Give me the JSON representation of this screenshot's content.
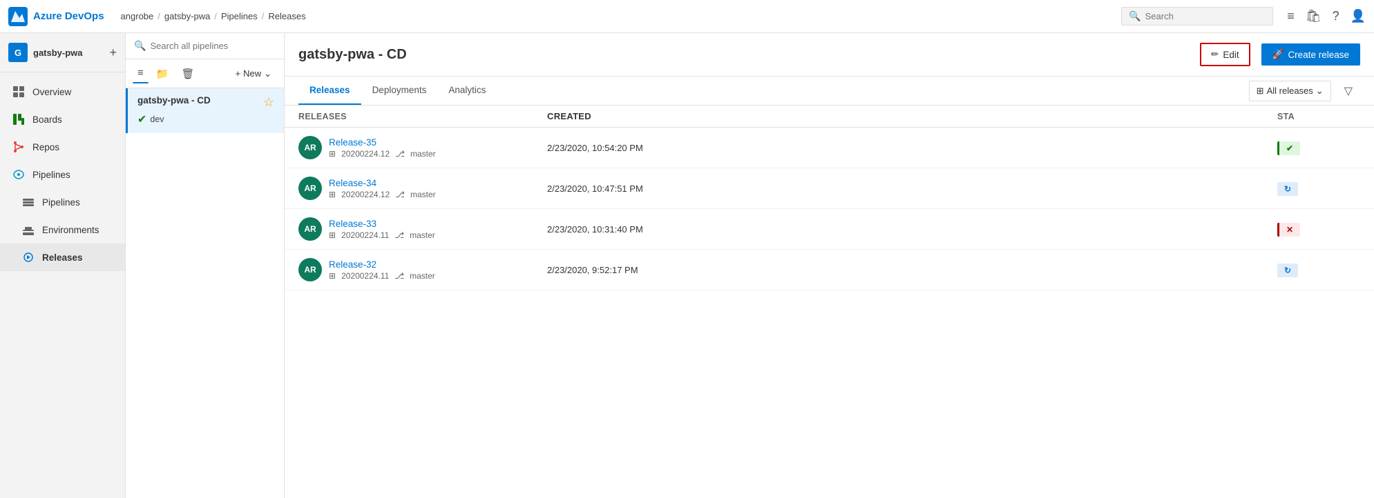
{
  "app": {
    "name": "Azure DevOps",
    "logo_color": "#0078d4"
  },
  "breadcrumb": {
    "items": [
      "angrobe",
      "/",
      "gatsby-pwa",
      "/",
      "Pipelines",
      "/",
      "Releases"
    ]
  },
  "topbar": {
    "search_placeholder": "Search"
  },
  "sidebar": {
    "project_initial": "G",
    "project_name": "gatsby-pwa",
    "items": [
      {
        "id": "overview",
        "label": "Overview",
        "icon": "overview"
      },
      {
        "id": "boards",
        "label": "Boards",
        "icon": "boards"
      },
      {
        "id": "repos",
        "label": "Repos",
        "icon": "repos"
      },
      {
        "id": "pipelines-group",
        "label": "Pipelines",
        "icon": "pipelines",
        "group": true
      },
      {
        "id": "pipelines",
        "label": "Pipelines",
        "icon": "pipelines-sub"
      },
      {
        "id": "environments",
        "label": "Environments",
        "icon": "environments"
      },
      {
        "id": "releases",
        "label": "Releases",
        "icon": "releases",
        "active": true
      }
    ]
  },
  "pipeline_panel": {
    "search_placeholder": "Search all pipelines",
    "toolbar": {
      "list_label": "List view",
      "folder_label": "Folder",
      "delete_label": "Delete",
      "new_label": "New",
      "chevron_label": "More"
    },
    "selected_pipeline": {
      "name": "gatsby-pwa - CD",
      "env": "dev",
      "env_status": "success"
    }
  },
  "content": {
    "title": "gatsby-pwa - CD",
    "edit_label": "Edit",
    "create_release_label": "Create release",
    "tabs": [
      {
        "id": "releases",
        "label": "Releases",
        "active": true
      },
      {
        "id": "deployments",
        "label": "Deployments"
      },
      {
        "id": "analytics",
        "label": "Analytics"
      }
    ],
    "all_releases_label": "All releases",
    "table": {
      "col_releases": "Releases",
      "col_created": "Created",
      "col_status": "Sta",
      "rows": [
        {
          "avatar": "AR",
          "name": "Release-35",
          "build": "20200224.12",
          "branch": "master",
          "created": "2/23/2020, 10:54:20 PM",
          "status": "success"
        },
        {
          "avatar": "AR",
          "name": "Release-34",
          "build": "20200224.12",
          "branch": "master",
          "created": "2/23/2020, 10:47:51 PM",
          "status": "inprogress"
        },
        {
          "avatar": "AR",
          "name": "Release-33",
          "build": "20200224.11",
          "branch": "master",
          "created": "2/23/2020, 10:31:40 PM",
          "status": "failed"
        },
        {
          "avatar": "AR",
          "name": "Release-32",
          "build": "20200224.11",
          "branch": "master",
          "created": "2/23/2020, 9:52:17 PM",
          "status": "inprogress"
        }
      ]
    }
  }
}
